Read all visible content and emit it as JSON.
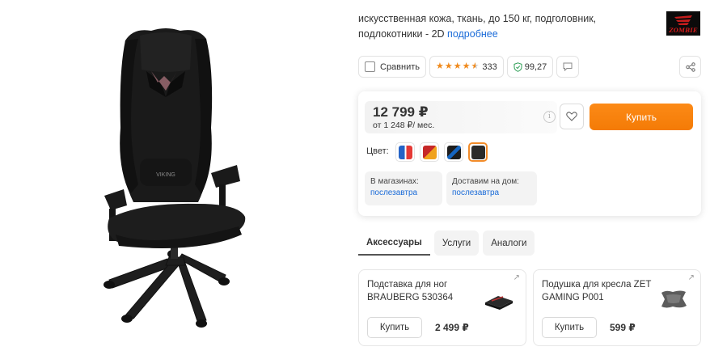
{
  "product": {
    "desc_text": "искусственная кожа, ткань, до 150 кг, подголовник, подлокотники - 2D",
    "more_link": "подробнее",
    "brand_logo": "ZOMBIE",
    "chair_badge": "VIKING"
  },
  "actions": {
    "compare_label": "Сравнить",
    "rating_stars": 4.5,
    "reviews_count": "333",
    "reliability": "99,27",
    "icons": [
      "checkbox-icon",
      "star-icon",
      "shield-icon",
      "chat-icon",
      "share-icon"
    ]
  },
  "buy_block": {
    "price": "12 799 ₽",
    "installment": "от 1 248 ₽/ мес.",
    "buy_label": "Купить",
    "color_label": "Цвет:",
    "colors": [
      {
        "name": "blue-white",
        "a": "#2563c6",
        "b": "#e53935"
      },
      {
        "name": "red-orange",
        "a": "#c62828",
        "b": "#f0a21c"
      },
      {
        "name": "blue-black",
        "a": "#1565c0",
        "b": "#1d1d1d"
      },
      {
        "name": "black",
        "a": "#2b2b2b",
        "b": "#2b2b2b"
      }
    ],
    "selected_color_index": 3,
    "accent_color": "#f58a11",
    "link_color": "#1a6bd8"
  },
  "delivery": [
    {
      "title": "В магазинах:",
      "value": "послезавтра"
    },
    {
      "title": "Доставим на дом:",
      "value": "послезавтра"
    }
  ],
  "tabs": [
    "Аксессуары",
    "Услуги",
    "Аналоги"
  ],
  "accessories": [
    {
      "name": "Подставка для ног BRAUBERG 530364",
      "buy_label": "Купить",
      "price": "2 499 ₽"
    },
    {
      "name": "Подушка для кресла ZET GAMING P001",
      "buy_label": "Купить",
      "price": "599 ₽"
    }
  ]
}
